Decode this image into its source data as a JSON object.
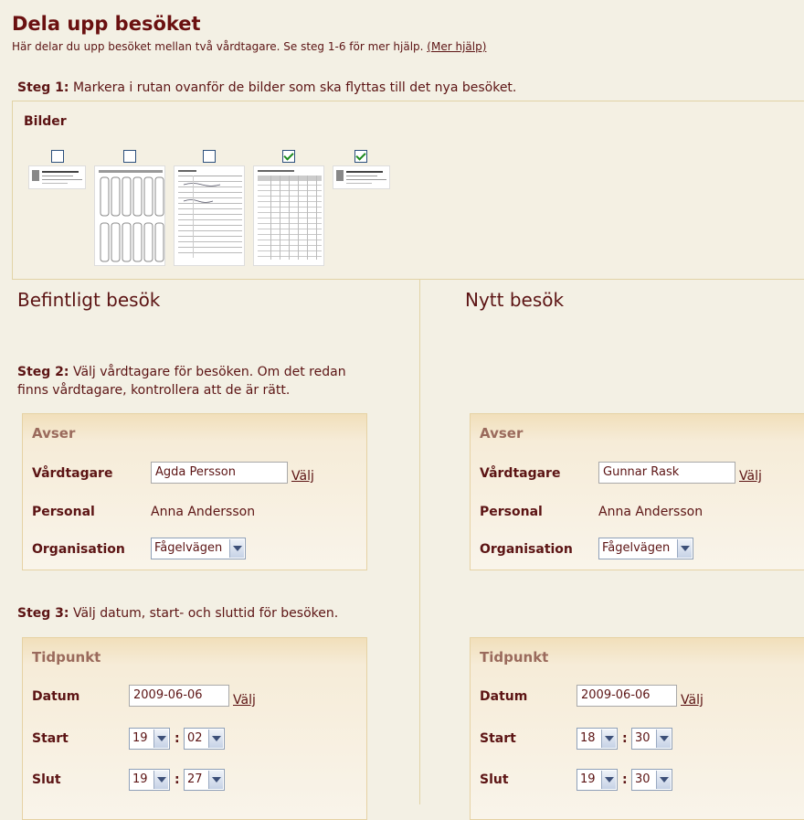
{
  "header": {
    "title": "Dela upp besöket",
    "subtitle": "Här delar du upp besöket mellan två vårdtagare. Se steg 1-6 för mer hjälp.",
    "help_link": "(Mer hjälp)"
  },
  "step1": {
    "label": "Steg 1:",
    "text": "Markera i rutan ovanför de bilder som ska flyttas till det nya besöket."
  },
  "bilder": {
    "title": "Bilder",
    "images": [
      {
        "checked": false
      },
      {
        "checked": false
      },
      {
        "checked": false
      },
      {
        "checked": true
      },
      {
        "checked": true
      }
    ]
  },
  "existing": {
    "title": "Befintligt besök"
  },
  "new": {
    "title": "Nytt besök"
  },
  "step2": {
    "label": "Steg 2:",
    "text_line1": "Välj vårdtagare för besöken. Om det redan",
    "text_line2": "finns vårdtagare, kontrollera att de är rätt."
  },
  "step3": {
    "label": "Steg 3:",
    "text": "Välj datum, start- och sluttid för besöken."
  },
  "avser_left": {
    "title": "Avser",
    "patient_label": "Vårdtagare",
    "patient_value": "Agda Persson",
    "choose": "Välj",
    "staff_label": "Personal",
    "staff_value": "Anna Andersson",
    "org_label": "Organisation",
    "org_value": "Fågelvägen"
  },
  "avser_right": {
    "title": "Avser",
    "patient_label": "Vårdtagare",
    "patient_value": "Gunnar Rask",
    "choose": "Välj",
    "staff_label": "Personal",
    "staff_value": "Anna Andersson",
    "org_label": "Organisation",
    "org_value": "Fågelvägen"
  },
  "tid_left": {
    "title": "Tidpunkt",
    "date_label": "Datum",
    "date_value": "2009-06-06",
    "choose": "Välj",
    "start_label": "Start",
    "start_h": "19",
    "start_m": "02",
    "end_label": "Slut",
    "end_h": "19",
    "end_m": "27",
    "colon": ":"
  },
  "tid_right": {
    "title": "Tidpunkt",
    "date_label": "Datum",
    "date_value": "2009-06-06",
    "choose": "Välj",
    "start_label": "Start",
    "start_h": "18",
    "start_m": "30",
    "end_label": "Slut",
    "end_h": "19",
    "end_m": "30",
    "colon": ":"
  }
}
